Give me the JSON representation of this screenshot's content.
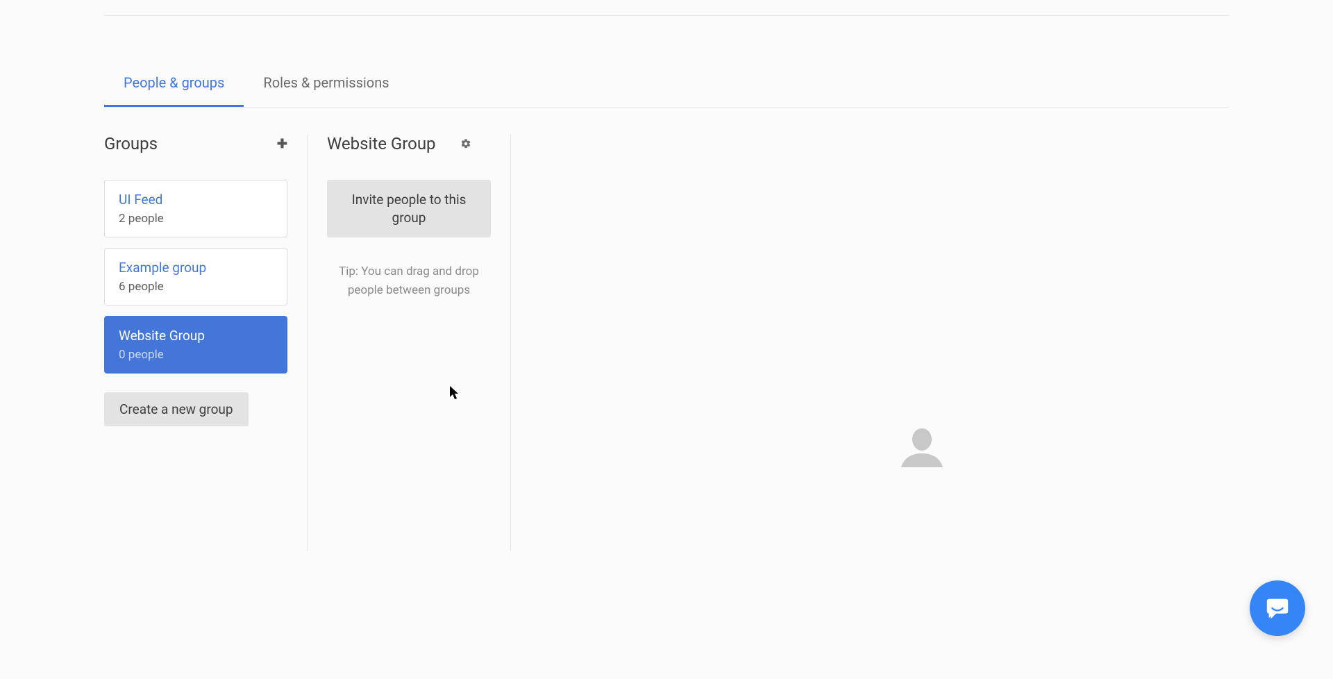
{
  "tabs": [
    {
      "label": "People & groups",
      "active": true
    },
    {
      "label": "Roles & permissions",
      "active": false
    }
  ],
  "groups": {
    "header": "Groups",
    "items": [
      {
        "name": "UI Feed",
        "count": "2 people",
        "active": false
      },
      {
        "name": "Example group",
        "count": "6 people",
        "active": false
      },
      {
        "name": "Website Group",
        "count": "0 people",
        "active": true
      }
    ],
    "create_label": "Create a new group"
  },
  "detail": {
    "title": "Website Group",
    "invite_label": "Invite people to this group",
    "tip": "Tip: You can drag and drop people between groups"
  }
}
